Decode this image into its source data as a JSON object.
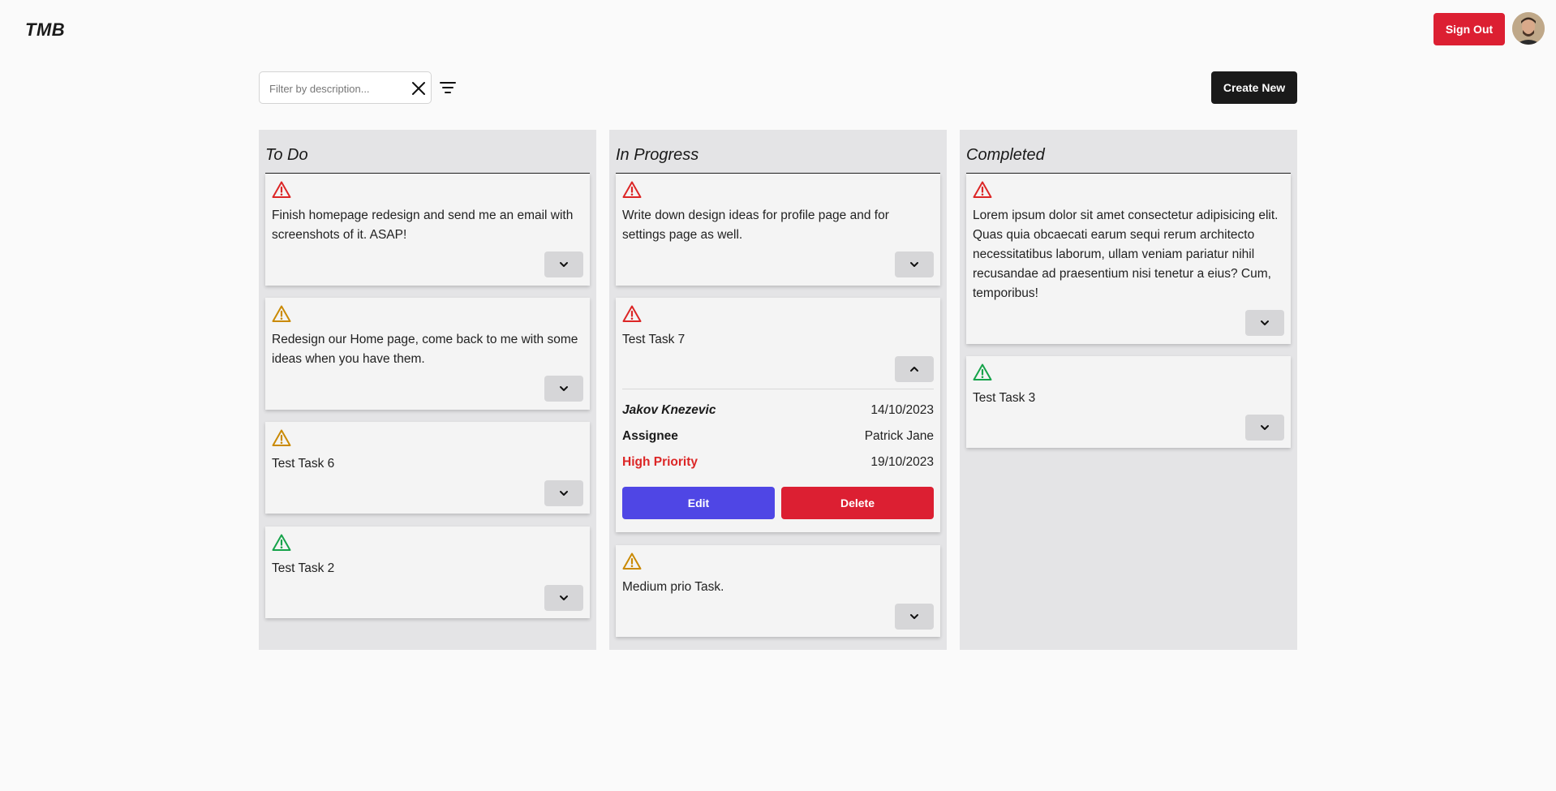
{
  "app": {
    "logo": "TMB",
    "sign_out_label": "Sign Out"
  },
  "toolbar": {
    "filter_placeholder": "Filter by description...",
    "filter_value": "",
    "create_label": "Create New"
  },
  "colors": {
    "high": "#dc2626",
    "medium": "#ca8a04",
    "low": "#16a34a",
    "edit": "#4f46e5",
    "delete": "#dc1f32"
  },
  "columns": [
    {
      "title": "To Do",
      "cards": [
        {
          "priority": "high",
          "text": "Finish homepage redesign and send me an email with screenshots of it. ASAP!"
        },
        {
          "priority": "medium",
          "text": "Redesign our Home page, come back to me with some ideas when you have them."
        },
        {
          "priority": "medium",
          "text": "Test Task 6"
        },
        {
          "priority": "low",
          "text": "Test Task 2"
        }
      ]
    },
    {
      "title": "In Progress",
      "cards": [
        {
          "priority": "high",
          "text": "Write down design ideas for profile page and for settings page as well."
        },
        {
          "priority": "high",
          "text": "Test Task 7",
          "expanded": true,
          "details": {
            "author": "Jakov Knezevic",
            "created": "14/10/2023",
            "assignee_label": "Assignee",
            "assignee": "Patrick Jane",
            "priority_label": "High Priority",
            "due": "19/10/2023",
            "edit_label": "Edit",
            "delete_label": "Delete"
          }
        },
        {
          "priority": "medium",
          "text": "Medium prio Task."
        }
      ]
    },
    {
      "title": "Completed",
      "cards": [
        {
          "priority": "high",
          "text": "Lorem ipsum dolor sit amet consectetur adipisicing elit. Quas quia obcaecati earum sequi rerum architecto necessitatibus laborum, ullam veniam pariatur nihil recusandae ad praesentium nisi tenetur a eius? Cum, temporibus!"
        },
        {
          "priority": "low",
          "text": "Test Task 3"
        }
      ]
    }
  ]
}
